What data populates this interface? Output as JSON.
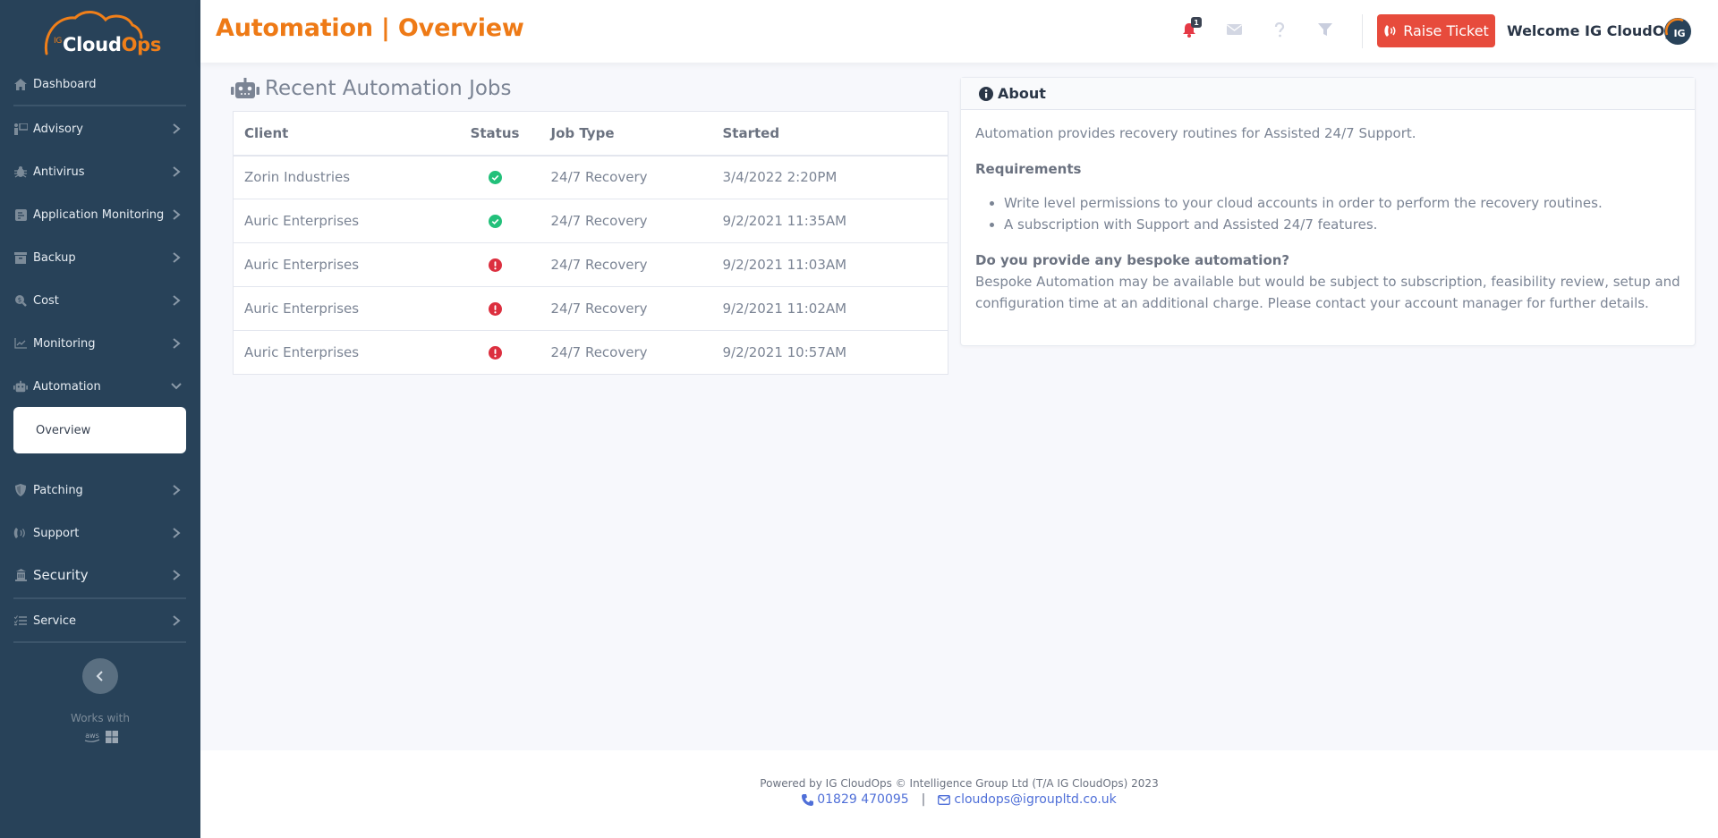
{
  "brand": {
    "logo_prefix": "IG",
    "logo_main": "Cloud",
    "logo_accent": "Ops",
    "accent_color": "#ee7a16",
    "sidebar_bg": "#284259"
  },
  "sidebar": {
    "items": [
      {
        "label": "Dashboard",
        "icon": "home-icon"
      },
      {
        "label": "Advisory",
        "icon": "advisory-icon"
      },
      {
        "label": "Antivirus",
        "icon": "bug-icon"
      },
      {
        "label": "Application Monitoring",
        "icon": "document-icon"
      },
      {
        "label": "Backup",
        "icon": "archive-icon"
      },
      {
        "label": "Cost",
        "icon": "search-dollar-icon"
      },
      {
        "label": "Monitoring",
        "icon": "chart-line-icon"
      },
      {
        "label": "Automation",
        "icon": "robot-icon",
        "expanded": true
      },
      {
        "label": "Patching",
        "icon": "shield-icon"
      },
      {
        "label": "Support",
        "icon": "phone-volume-icon"
      },
      {
        "label": "Security",
        "icon": "building-icon"
      },
      {
        "label": "Service",
        "icon": "tasks-icon"
      }
    ],
    "active_sub_item": "Overview",
    "works_with": "Works with",
    "works_with_logos": [
      "aws",
      "windows"
    ]
  },
  "header": {
    "title": "Automation | Overview",
    "notification_count": "1",
    "raise_ticket_label": "Raise Ticket",
    "welcome": "Welcome IG CloudOps",
    "avatar_initials": "IG"
  },
  "jobs": {
    "title": "Recent Automation Jobs",
    "columns": [
      "Client",
      "Status",
      "Job Type",
      "Started"
    ],
    "rows": [
      {
        "client": "Zorin Industries",
        "status": "success",
        "job_type": "24/7 Recovery",
        "started": "3/4/2022 2:20PM"
      },
      {
        "client": "Auric Enterprises",
        "status": "success",
        "job_type": "24/7 Recovery",
        "started": "9/2/2021 11:35AM"
      },
      {
        "client": "Auric Enterprises",
        "status": "error",
        "job_type": "24/7 Recovery",
        "started": "9/2/2021 11:03AM"
      },
      {
        "client": "Auric Enterprises",
        "status": "error",
        "job_type": "24/7 Recovery",
        "started": "9/2/2021 11:02AM"
      },
      {
        "client": "Auric Enterprises",
        "status": "error",
        "job_type": "24/7 Recovery",
        "started": "9/2/2021 10:57AM"
      }
    ],
    "status_colors": {
      "success": "#22c07a",
      "error": "#dc2f3f"
    }
  },
  "about": {
    "title": "About",
    "intro": "Automation provides recovery routines for Assisted 24/7 Support.",
    "requirements_title": "Requirements",
    "requirements": [
      "Write level permissions to your cloud accounts in order to perform the recovery routines.",
      "A subscription with Support and Assisted 24/7 features."
    ],
    "question": "Do you provide any bespoke automation?",
    "answer": "Bespoke Automation may be available but would be subject to subscription, feasibility review, setup and configuration time at an additional charge. Please contact your account manager for further details."
  },
  "footer": {
    "powered_by": "Powered by IG CloudOps © Intelligence Group Ltd (T/A IG CloudOps) 2023",
    "phone": "01829 470095",
    "separator": "|",
    "email": "cloudops@igroupltd.co.uk"
  }
}
